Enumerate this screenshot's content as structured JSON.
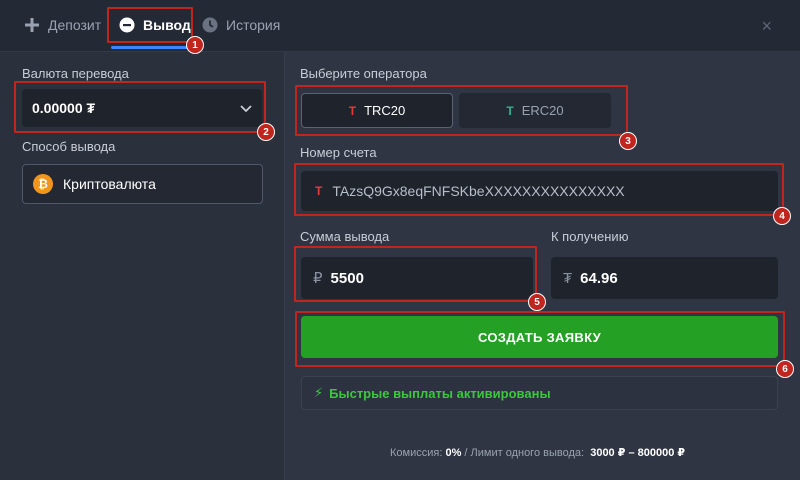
{
  "tabs": [
    {
      "label": "Депозит",
      "icon": "plus-icon"
    },
    {
      "label": "Вывод",
      "icon": "minus-circle-icon"
    },
    {
      "label": "История",
      "icon": "clock-icon"
    }
  ],
  "close_glyph": "×",
  "left": {
    "currency_label": "Валюта перевода",
    "currency_value": "0.00000 ₮",
    "method_label": "Способ вывода",
    "method_value": "Криптовалюта",
    "method_icon_glyph": "₿"
  },
  "right": {
    "operator_label": "Выберите оператора",
    "operators": [
      {
        "label": "TRC20",
        "glyph": "T",
        "selected": true
      },
      {
        "label": "ERC20",
        "glyph": "T",
        "selected": false
      }
    ],
    "account_label": "Номер счета",
    "account_glyph": "T",
    "account_value": "TAzsQ9Gx8eqFNFSKbeXXXXXXXXXXXXXXX",
    "amount_label": "Сумма вывода",
    "amount_currency": "₽",
    "amount_value": "5500",
    "receive_label": "К получению",
    "receive_currency": "₮",
    "receive_value": "64.96",
    "submit_label": "СОЗДАТЬ ЗАЯВКУ",
    "fast_payout_label": "Быстрые выплаты активированы",
    "fast_payout_glyph": "⚡"
  },
  "footer": {
    "commission_prefix": "Комиссия:",
    "commission_value": "0%",
    "limit_prefix": "/ Лимит одного вывода:",
    "limit_value": "3000 ₽ – 800000 ₽"
  },
  "callouts": [
    "1",
    "2",
    "3",
    "4",
    "5",
    "6"
  ],
  "colors": {
    "accent_blue": "#3a86ff",
    "submit_green": "#24a125",
    "fast_green": "#3ec63f",
    "callout_red": "#c0261e",
    "trc_red": "#e53a3a",
    "erc_green": "#2bb58f",
    "btc_orange": "#f2951c"
  }
}
